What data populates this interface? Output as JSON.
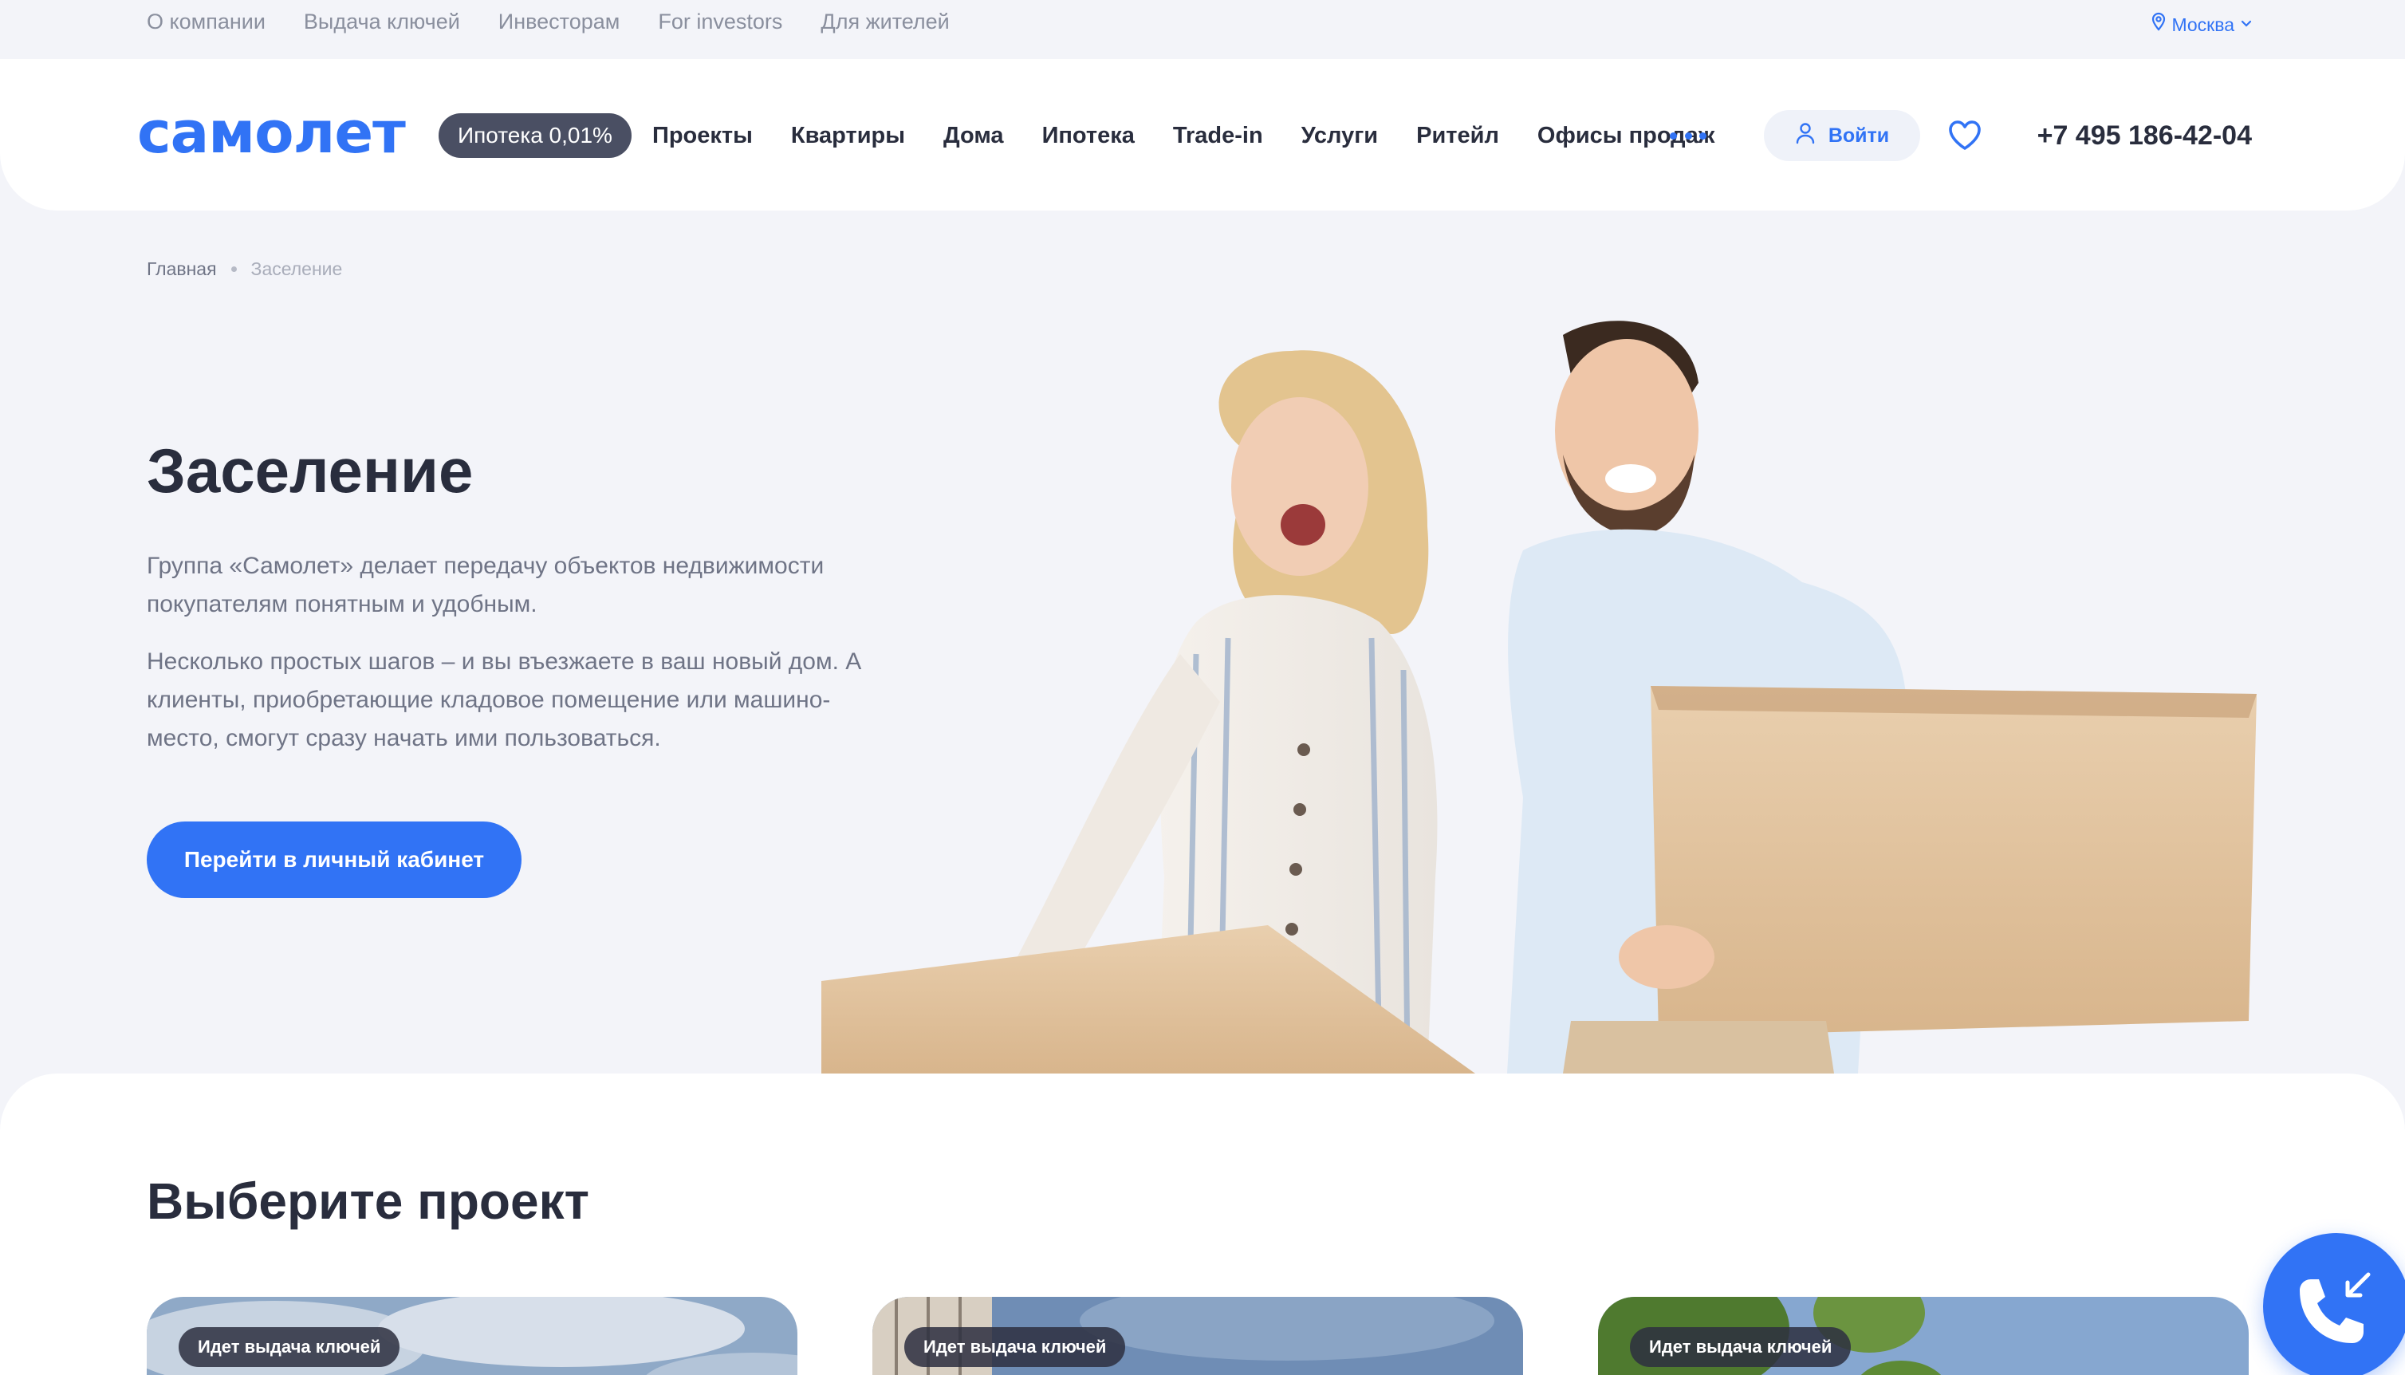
{
  "topbar": {
    "links": [
      "О компании",
      "Выдача ключей",
      "Инвесторам",
      "For investors",
      "Для жителей"
    ],
    "city": "Москва"
  },
  "header": {
    "logo": "самолет",
    "promo": "Ипотека 0,01%",
    "nav": [
      "Проекты",
      "Квартиры",
      "Дома",
      "Ипотека",
      "Trade-in",
      "Услуги",
      "Ритейл",
      "Офисы продаж"
    ],
    "login": "Войти",
    "phone": "+7 495 186-42-04"
  },
  "breadcrumb": {
    "home": "Главная",
    "current": "Заселение"
  },
  "hero": {
    "title": "Заселение",
    "paragraph_1": "Группа «Самолет» делает передачу объектов недвижимости покупателям понятным и удобным.",
    "paragraph_2": "Несколько простых шагов – и вы въезжаете в ваш новый дом. А клиенты, приобретающие кладовое помещение или машино-место, смогут сразу начать ими пользоваться.",
    "cta": "Перейти в личный кабинет"
  },
  "projects": {
    "title": "Выберите проект",
    "cards": [
      {
        "badge": "Идет выдача ключей"
      },
      {
        "badge": "Идет выдача ключей"
      },
      {
        "badge": "Идет выдача ключей"
      }
    ]
  },
  "colors": {
    "brand": "#3173f5",
    "page_bg": "#f3f4f9",
    "text": "#292d3d",
    "muted": "#6f7486"
  },
  "icons": {
    "city": "location-pin-icon",
    "city_chevron": "chevron-down-icon",
    "more": "more-dots-icon",
    "login": "user-icon",
    "favorites": "heart-icon",
    "call": "phone-callback-icon"
  }
}
